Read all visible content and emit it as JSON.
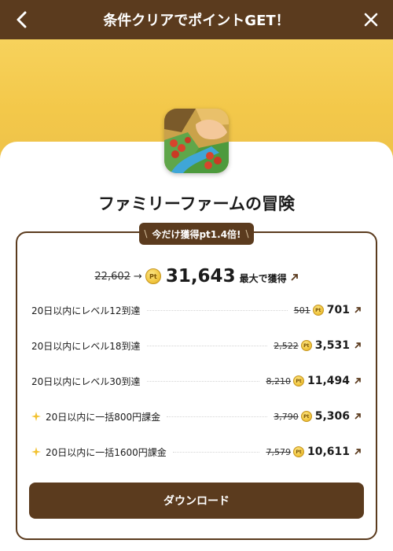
{
  "header": {
    "title": "条件クリアでポイントGET！"
  },
  "app": {
    "name": "ファミリーファームの冒険"
  },
  "promo": {
    "ribbon": "今だけ獲得pt1.4倍!"
  },
  "max_points": {
    "old": "22,602",
    "new": "31,643",
    "suffix": "最大で獲得"
  },
  "conditions": [
    {
      "label": "20日以内にレベル12到達",
      "old": "501",
      "new": "701",
      "star": false
    },
    {
      "label": "20日以内にレベル18到達",
      "old": "2,522",
      "new": "3,531",
      "star": false
    },
    {
      "label": "20日以内にレベル30到達",
      "old": "8,210",
      "new": "11,494",
      "star": false
    },
    {
      "label": "20日以内に一括800円課金",
      "old": "3,790",
      "new": "5,306",
      "star": true
    },
    {
      "label": "20日以内に一括1600円課金",
      "old": "7,579",
      "new": "10,611",
      "star": true
    }
  ],
  "coin_label": "Pt",
  "download_label": "ダウンロード",
  "colors": {
    "brand_brown": "#5b3b1e",
    "banner_gold": "#f3c84a",
    "star_gold": "#f2c230"
  },
  "icons": [
    "back-arrow-icon",
    "close-icon",
    "pt-coin-icon",
    "external-link-icon",
    "sparkle-star-icon"
  ]
}
